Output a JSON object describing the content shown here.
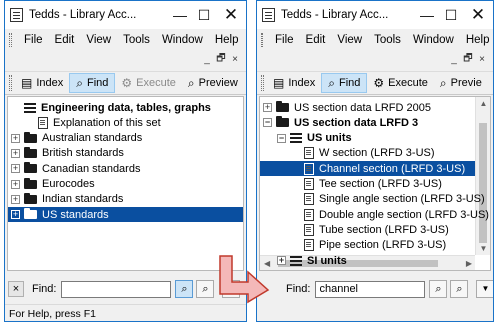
{
  "left": {
    "title": "Tedds - Library Acc...",
    "window_buttons": {
      "minimize": "—",
      "maximize": "☐",
      "close": "✕"
    },
    "menu": [
      "File",
      "Edit",
      "View",
      "Tools",
      "Window",
      "Help"
    ],
    "mdi_buttons": [
      "_",
      "🗗",
      "×"
    ],
    "toolbar": {
      "index": "Index",
      "find": "Find",
      "execute": "Execute",
      "preview": "Preview"
    },
    "tree": [
      {
        "label": "Engineering data, tables, graphs",
        "type": "stack",
        "expand": "",
        "level": 0,
        "bold": true
      },
      {
        "label": "Explanation of this set",
        "type": "doc",
        "expand": "",
        "level": 1
      },
      {
        "label": "Australian standards",
        "type": "folder",
        "expand": "+",
        "level": 0
      },
      {
        "label": "British standards",
        "type": "folder",
        "expand": "+",
        "level": 0
      },
      {
        "label": "Canadian standards",
        "type": "folder",
        "expand": "+",
        "level": 0
      },
      {
        "label": "Eurocodes",
        "type": "folder",
        "expand": "+",
        "level": 0
      },
      {
        "label": "Indian standards",
        "type": "folder",
        "expand": "+",
        "level": 0
      },
      {
        "label": "US standards",
        "type": "folder",
        "expand": "+",
        "level": 0,
        "selected": true
      }
    ],
    "find": {
      "label": "Find:",
      "value": "",
      "close": "×"
    },
    "status": "For Help, press F1"
  },
  "right": {
    "title": "Tedds - Library Acc...",
    "window_buttons": {
      "minimize": "—",
      "maximize": "☐",
      "close": "✕"
    },
    "menu": [
      "File",
      "Edit",
      "View",
      "Tools",
      "Window",
      "Help"
    ],
    "mdi_buttons": [
      "_",
      "🗗",
      "×"
    ],
    "toolbar": {
      "index": "Index",
      "find": "Find",
      "execute": "Execute",
      "preview": "Previe"
    },
    "tree": [
      {
        "label": "US section data LRFD 2005",
        "type": "folder",
        "expand": "+",
        "level": 0
      },
      {
        "label": "US section data LRFD 3",
        "type": "folder",
        "expand": "−",
        "level": 0,
        "bold": true
      },
      {
        "label": "US units",
        "type": "stack",
        "expand": "−",
        "level": 1,
        "bold": true
      },
      {
        "label": "W section (LRFD 3-US)",
        "type": "doc",
        "expand": "",
        "level": 2
      },
      {
        "label": "Channel section (LRFD 3-US)",
        "type": "doc",
        "expand": "",
        "level": 2,
        "selected": true
      },
      {
        "label": "Tee section (LRFD 3-US)",
        "type": "doc",
        "expand": "",
        "level": 2
      },
      {
        "label": "Single angle section (LRFD 3-US)",
        "type": "doc",
        "expand": "",
        "level": 2
      },
      {
        "label": "Double angle section (LRFD 3-US)",
        "type": "doc",
        "expand": "",
        "level": 2
      },
      {
        "label": "Tube section (LRFD 3-US)",
        "type": "doc",
        "expand": "",
        "level": 2
      },
      {
        "label": "Pipe section (LRFD 3-US)",
        "type": "doc",
        "expand": "",
        "level": 2
      },
      {
        "label": "SI units",
        "type": "stack",
        "expand": "+",
        "level": 1,
        "bold": true
      }
    ],
    "find": {
      "label": "Find:",
      "value": "channel"
    }
  },
  "colors": {
    "selection": "#0a4fa0",
    "window_border": "#1a73c8",
    "arrow_fill": "#f4b8b8",
    "arrow_stroke": "#c0392b"
  }
}
